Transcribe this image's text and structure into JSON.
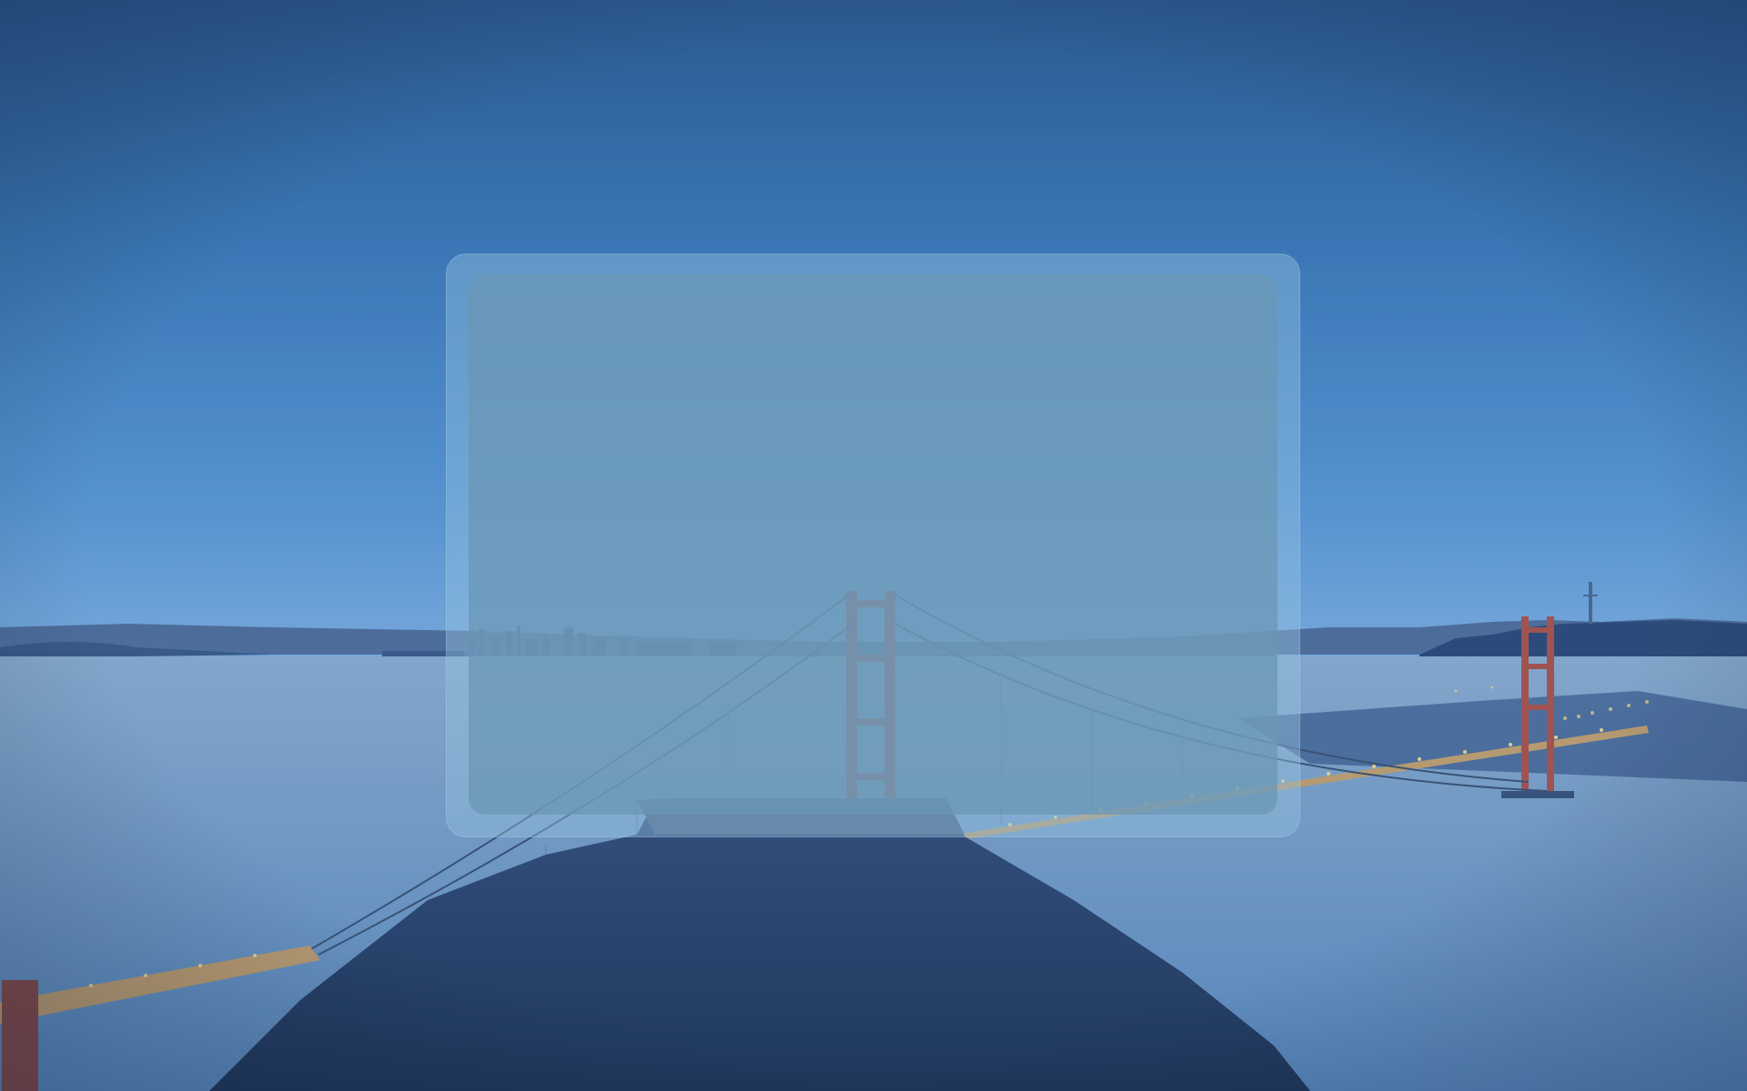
{
  "screen": {
    "name": "desktop-with-dimmed-dialog",
    "wallpaper": "golden-gate-bridge-at-dawn"
  },
  "colors": {
    "sky_top": "#2f5f96",
    "sky_mid": "#4a90d0",
    "sky_horizon": "#88b6e6",
    "horizon_glow": "#e7c96a",
    "water": "#6f9cc6",
    "hill": "#2a4268",
    "bridge_tower": "#b0554a",
    "city_lights": "#f3d98a",
    "dialog_frame": "#96c3e1",
    "dialog_panel": "#6996b4"
  },
  "dialog": {
    "state": "loading-empty"
  }
}
